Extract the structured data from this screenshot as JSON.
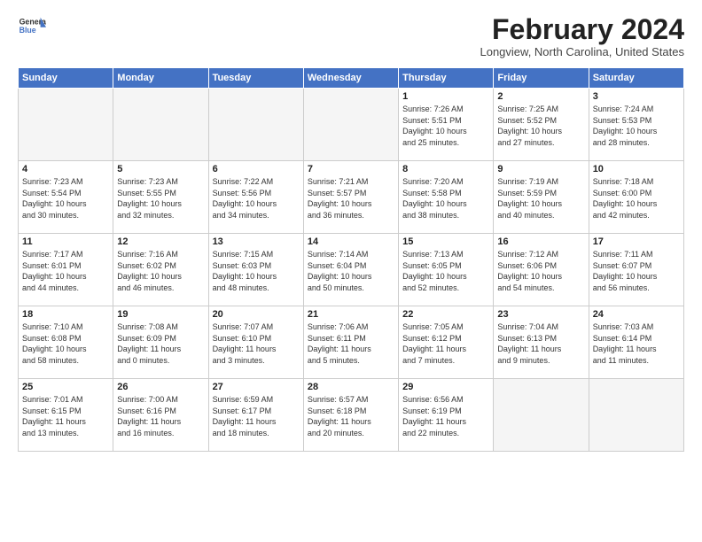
{
  "header": {
    "logo_line1": "General",
    "logo_line2": "Blue",
    "month": "February 2024",
    "location": "Longview, North Carolina, United States"
  },
  "weekdays": [
    "Sunday",
    "Monday",
    "Tuesday",
    "Wednesday",
    "Thursday",
    "Friday",
    "Saturday"
  ],
  "weeks": [
    [
      {
        "day": "",
        "info": "",
        "empty": true
      },
      {
        "day": "",
        "info": "",
        "empty": true
      },
      {
        "day": "",
        "info": "",
        "empty": true
      },
      {
        "day": "",
        "info": "",
        "empty": true
      },
      {
        "day": "1",
        "info": "Sunrise: 7:26 AM\nSunset: 5:51 PM\nDaylight: 10 hours\nand 25 minutes."
      },
      {
        "day": "2",
        "info": "Sunrise: 7:25 AM\nSunset: 5:52 PM\nDaylight: 10 hours\nand 27 minutes."
      },
      {
        "day": "3",
        "info": "Sunrise: 7:24 AM\nSunset: 5:53 PM\nDaylight: 10 hours\nand 28 minutes."
      }
    ],
    [
      {
        "day": "4",
        "info": "Sunrise: 7:23 AM\nSunset: 5:54 PM\nDaylight: 10 hours\nand 30 minutes."
      },
      {
        "day": "5",
        "info": "Sunrise: 7:23 AM\nSunset: 5:55 PM\nDaylight: 10 hours\nand 32 minutes."
      },
      {
        "day": "6",
        "info": "Sunrise: 7:22 AM\nSunset: 5:56 PM\nDaylight: 10 hours\nand 34 minutes."
      },
      {
        "day": "7",
        "info": "Sunrise: 7:21 AM\nSunset: 5:57 PM\nDaylight: 10 hours\nand 36 minutes."
      },
      {
        "day": "8",
        "info": "Sunrise: 7:20 AM\nSunset: 5:58 PM\nDaylight: 10 hours\nand 38 minutes."
      },
      {
        "day": "9",
        "info": "Sunrise: 7:19 AM\nSunset: 5:59 PM\nDaylight: 10 hours\nand 40 minutes."
      },
      {
        "day": "10",
        "info": "Sunrise: 7:18 AM\nSunset: 6:00 PM\nDaylight: 10 hours\nand 42 minutes."
      }
    ],
    [
      {
        "day": "11",
        "info": "Sunrise: 7:17 AM\nSunset: 6:01 PM\nDaylight: 10 hours\nand 44 minutes."
      },
      {
        "day": "12",
        "info": "Sunrise: 7:16 AM\nSunset: 6:02 PM\nDaylight: 10 hours\nand 46 minutes."
      },
      {
        "day": "13",
        "info": "Sunrise: 7:15 AM\nSunset: 6:03 PM\nDaylight: 10 hours\nand 48 minutes."
      },
      {
        "day": "14",
        "info": "Sunrise: 7:14 AM\nSunset: 6:04 PM\nDaylight: 10 hours\nand 50 minutes."
      },
      {
        "day": "15",
        "info": "Sunrise: 7:13 AM\nSunset: 6:05 PM\nDaylight: 10 hours\nand 52 minutes."
      },
      {
        "day": "16",
        "info": "Sunrise: 7:12 AM\nSunset: 6:06 PM\nDaylight: 10 hours\nand 54 minutes."
      },
      {
        "day": "17",
        "info": "Sunrise: 7:11 AM\nSunset: 6:07 PM\nDaylight: 10 hours\nand 56 minutes."
      }
    ],
    [
      {
        "day": "18",
        "info": "Sunrise: 7:10 AM\nSunset: 6:08 PM\nDaylight: 10 hours\nand 58 minutes."
      },
      {
        "day": "19",
        "info": "Sunrise: 7:08 AM\nSunset: 6:09 PM\nDaylight: 11 hours\nand 0 minutes."
      },
      {
        "day": "20",
        "info": "Sunrise: 7:07 AM\nSunset: 6:10 PM\nDaylight: 11 hours\nand 3 minutes."
      },
      {
        "day": "21",
        "info": "Sunrise: 7:06 AM\nSunset: 6:11 PM\nDaylight: 11 hours\nand 5 minutes."
      },
      {
        "day": "22",
        "info": "Sunrise: 7:05 AM\nSunset: 6:12 PM\nDaylight: 11 hours\nand 7 minutes."
      },
      {
        "day": "23",
        "info": "Sunrise: 7:04 AM\nSunset: 6:13 PM\nDaylight: 11 hours\nand 9 minutes."
      },
      {
        "day": "24",
        "info": "Sunrise: 7:03 AM\nSunset: 6:14 PM\nDaylight: 11 hours\nand 11 minutes."
      }
    ],
    [
      {
        "day": "25",
        "info": "Sunrise: 7:01 AM\nSunset: 6:15 PM\nDaylight: 11 hours\nand 13 minutes."
      },
      {
        "day": "26",
        "info": "Sunrise: 7:00 AM\nSunset: 6:16 PM\nDaylight: 11 hours\nand 16 minutes."
      },
      {
        "day": "27",
        "info": "Sunrise: 6:59 AM\nSunset: 6:17 PM\nDaylight: 11 hours\nand 18 minutes."
      },
      {
        "day": "28",
        "info": "Sunrise: 6:57 AM\nSunset: 6:18 PM\nDaylight: 11 hours\nand 20 minutes."
      },
      {
        "day": "29",
        "info": "Sunrise: 6:56 AM\nSunset: 6:19 PM\nDaylight: 11 hours\nand 22 minutes."
      },
      {
        "day": "",
        "info": "",
        "empty": true
      },
      {
        "day": "",
        "info": "",
        "empty": true
      }
    ]
  ]
}
